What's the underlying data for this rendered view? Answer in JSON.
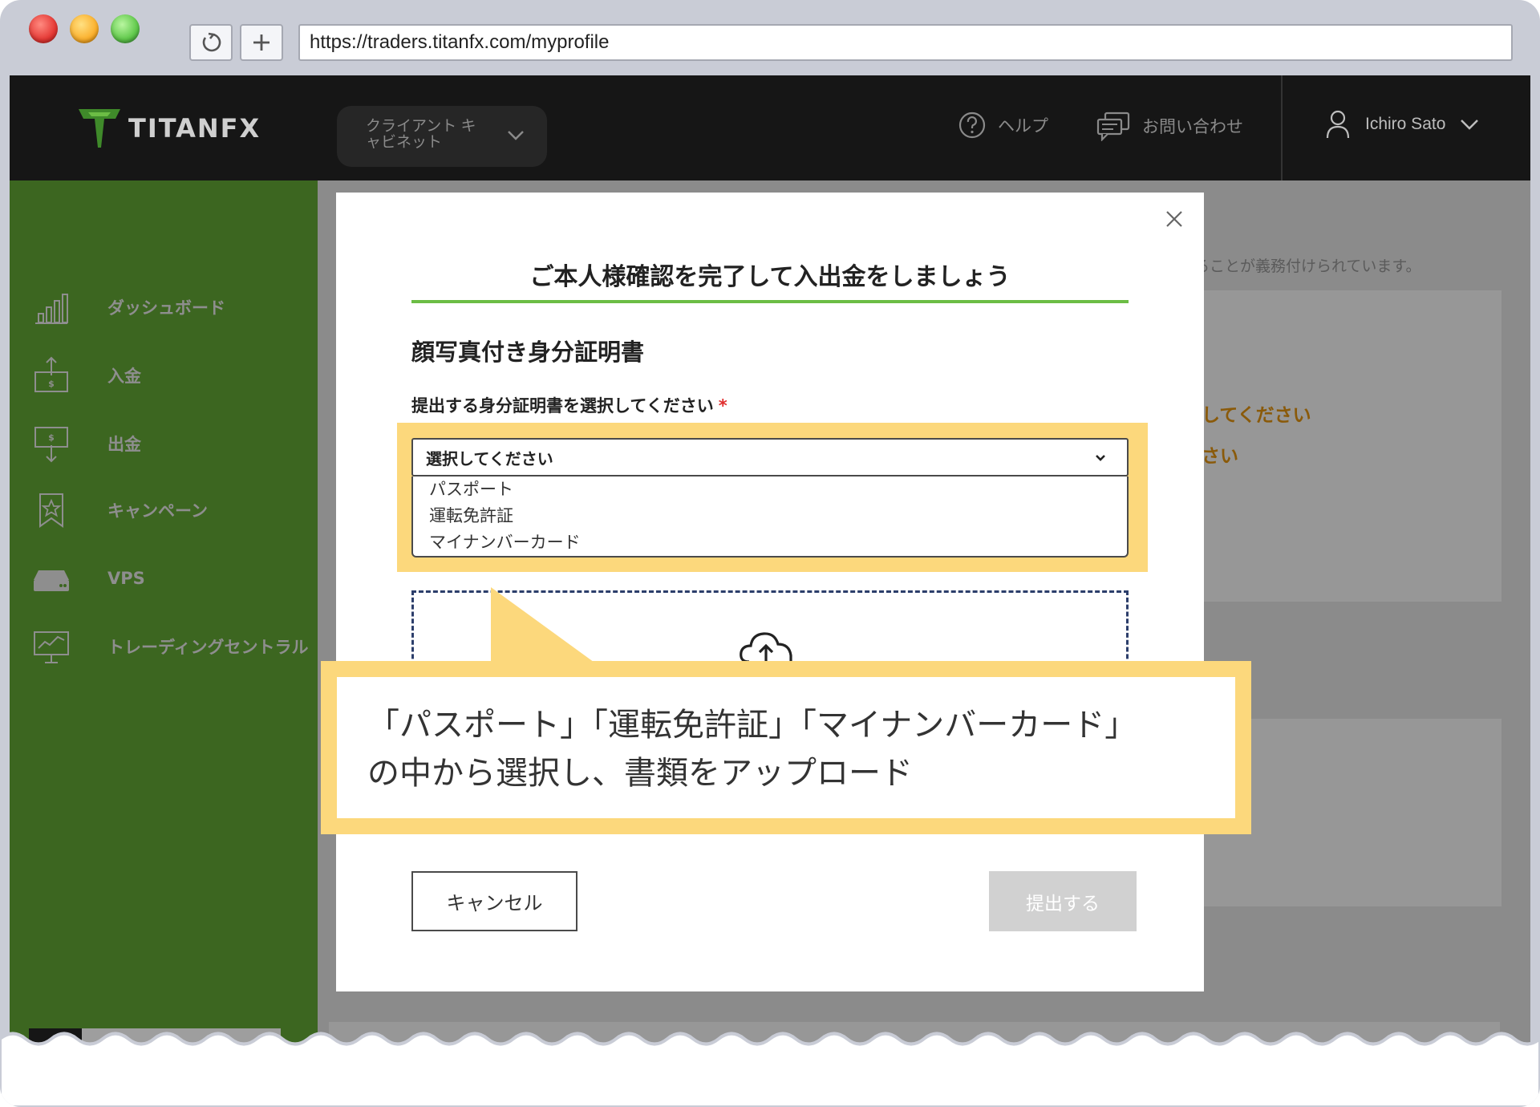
{
  "browser": {
    "url": "https://traders.titanfx.com/myprofile",
    "reload_icon": "reload-icon",
    "new_tab_icon": "plus-icon"
  },
  "header": {
    "logo_text": "TITANFX",
    "cabinet_label": "クライアント キャビネット",
    "help_label": "ヘルプ",
    "contact_label": "お問い合わせ",
    "user_name": "Ichiro Sato"
  },
  "sidebar": {
    "items": [
      {
        "label": "ダッシュボード",
        "icon": "bar-chart-icon"
      },
      {
        "label": "入金",
        "icon": "deposit-icon"
      },
      {
        "label": "出金",
        "icon": "withdraw-icon"
      },
      {
        "label": "キャンペーン",
        "icon": "star-bookmark-icon"
      },
      {
        "label": "VPS",
        "icon": "server-icon"
      },
      {
        "label": "トレーディングセントラル",
        "icon": "monitor-chart-icon"
      }
    ]
  },
  "background_page": {
    "notice": "することが義務付けられています。",
    "warning_1": "してください",
    "warning_2": "さい"
  },
  "modal": {
    "title": "ご本人様確認を完了して入出金をしましょう",
    "section_heading": "顔写真付き身分証明書",
    "select_label": "提出する身分証明書を選択してください",
    "required_mark": "*",
    "select_value": "選択してください",
    "options": [
      "パスポート",
      "運転免許証",
      "マイナンバーカード"
    ],
    "cancel_label": "キャンセル",
    "submit_label": "提出する"
  },
  "callout": {
    "line_1": "「パスポート」「運転免許証」「マイナンバーカード」",
    "line_2": "の中から選択し、書類をアップロード"
  },
  "colors": {
    "sidebar_green": "#3c6620",
    "accent_green": "#6cbd45",
    "highlight_yellow": "#fcd87c",
    "header_black": "#161616",
    "required_red": "#e02c2c"
  }
}
